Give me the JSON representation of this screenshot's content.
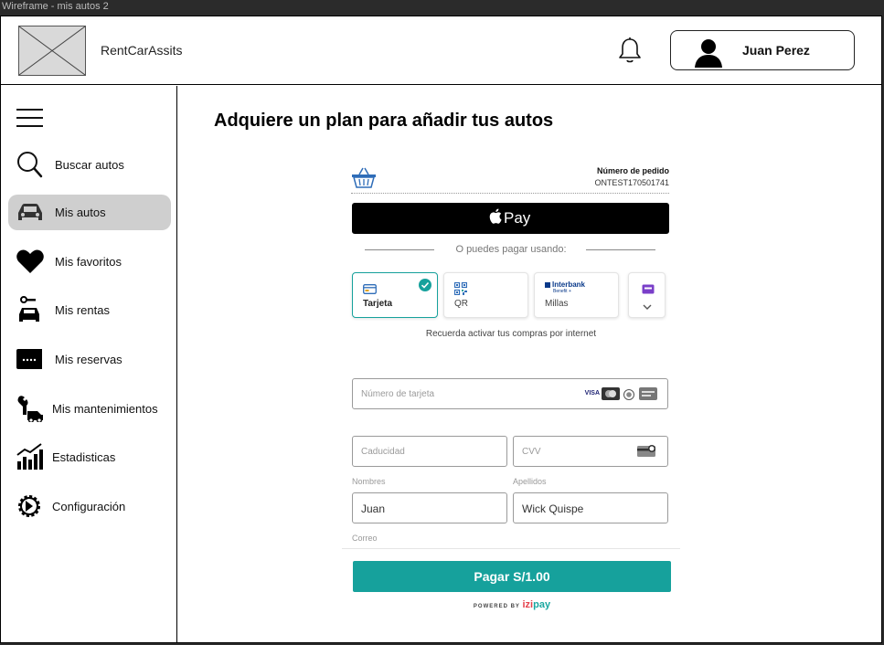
{
  "window": {
    "title": "Wireframe - mis autos 2"
  },
  "header": {
    "brand": "RentCarAssits",
    "user_name": "Juan Perez"
  },
  "sidebar": {
    "items": [
      {
        "label": "Buscar autos",
        "icon": "search-icon"
      },
      {
        "label": "Mis autos",
        "icon": "car-icon",
        "active": true
      },
      {
        "label": "Mis favoritos",
        "icon": "heart-icon"
      },
      {
        "label": "Mis rentas",
        "icon": "key-car-icon"
      },
      {
        "label": "Mis reservas",
        "icon": "ticket-icon"
      },
      {
        "label": "Mis mantenimientos",
        "icon": "wrench-truck-icon"
      },
      {
        "label": "Estadisticas",
        "icon": "chart-icon"
      },
      {
        "label": "Configuración",
        "icon": "gear-icon"
      }
    ]
  },
  "main": {
    "title": "Adquiere un plan para añadir tus autos"
  },
  "payment": {
    "order_label": "Número de pedido",
    "order_number": "ONTEST170501741",
    "apple_pay_label": "Pay",
    "or_text": "O puedes pagar usando:",
    "methods": [
      {
        "label": "Tarjeta",
        "selected": true,
        "icon": "card-icon"
      },
      {
        "label": "QR",
        "selected": false,
        "icon": "qr-icon"
      },
      {
        "label": "Millas",
        "selected": false,
        "icon": "interbank-icon",
        "brand": "Interbank",
        "sub": "Benefit +"
      },
      {
        "label": "",
        "selected": false,
        "icon": "more-chevron-icon"
      }
    ],
    "reminder": "Recuerda activar tus compras por internet",
    "card_number_placeholder": "Número de tarjeta",
    "card_brand_visa": "VISA",
    "expiry_placeholder": "Caducidad",
    "cvv_placeholder": "CVV",
    "names_label": "Nombres",
    "names_value": "Juan",
    "lastname_label": "Apellidos",
    "lastname_value": "Wick Quispe",
    "email_label": "Correo",
    "pay_button": "Pagar S/1.00",
    "powered_by": "POWERED BY",
    "izi_text": "izi",
    "pay_text": "pay"
  },
  "colors": {
    "accent": "#16a19c",
    "active_nav": "#cfcfcf",
    "apple_pay_bg": "#000000",
    "izi_red": "#e5424d"
  }
}
